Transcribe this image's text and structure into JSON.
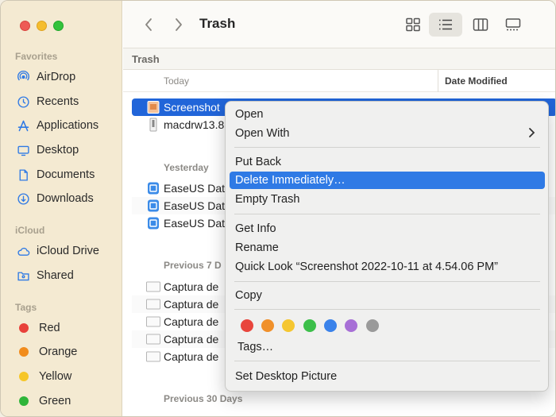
{
  "window": {
    "title": "Trash"
  },
  "sidebar": {
    "favorites_title": "Favorites",
    "favorites": [
      {
        "label": "AirDrop",
        "icon": "airdrop-icon"
      },
      {
        "label": "Recents",
        "icon": "clock-icon"
      },
      {
        "label": "Applications",
        "icon": "applications-icon"
      },
      {
        "label": "Desktop",
        "icon": "desktop-icon"
      },
      {
        "label": "Documents",
        "icon": "document-icon"
      },
      {
        "label": "Downloads",
        "icon": "download-icon"
      }
    ],
    "icloud_title": "iCloud",
    "icloud": [
      {
        "label": "iCloud Drive",
        "icon": "cloud-icon"
      },
      {
        "label": "Shared",
        "icon": "shared-folder-icon"
      }
    ],
    "tags_title": "Tags",
    "tags": [
      {
        "label": "Red",
        "color": "#e8413a"
      },
      {
        "label": "Orange",
        "color": "#f18c1c"
      },
      {
        "label": "Yellow",
        "color": "#f6c627"
      },
      {
        "label": "Green",
        "color": "#2fb53a"
      }
    ]
  },
  "toolbar": {
    "back_icon": "chevron-left-icon",
    "forward_icon": "chevron-right-icon",
    "views": [
      "icon-view-icon",
      "list-view-icon",
      "column-view-icon",
      "gallery-view-icon"
    ],
    "active_view": "list-view-icon"
  },
  "content": {
    "path_title": "Trash",
    "group_header": "Today",
    "date_column": "Date Modified",
    "groups": {
      "today": "Today",
      "yesterday": "Yesterday",
      "prev7": "Previous 7 D",
      "prev30": "Previous 30 Days"
    },
    "rows": {
      "r0": "Screenshot",
      "r1": "macdrw13.8",
      "r2": "EaseUS Dat",
      "r3": "EaseUS Dat",
      "r4": "EaseUS Dat",
      "r5": "Captura de",
      "r6": "Captura de",
      "r7": "Captura de",
      "r8": "Captura de",
      "r9": "Captura de"
    }
  },
  "context_menu": {
    "items": {
      "open": "Open",
      "open_with": "Open With",
      "put_back": "Put Back",
      "delete_immediately": "Delete Immediately…",
      "empty_trash": "Empty Trash",
      "get_info": "Get Info",
      "rename": "Rename",
      "quick_look": "Quick Look “Screenshot 2022-10-11 at 4.54.06 PM”",
      "copy": "Copy",
      "tags": "Tags…",
      "set_desktop_picture": "Set Desktop Picture"
    },
    "highlighted": "delete_immediately",
    "tag_colors": [
      "#e8453c",
      "#f0902a",
      "#f5c630",
      "#3cbf4a",
      "#3a82ea",
      "#a76fd6",
      "#9a9a9a"
    ]
  }
}
